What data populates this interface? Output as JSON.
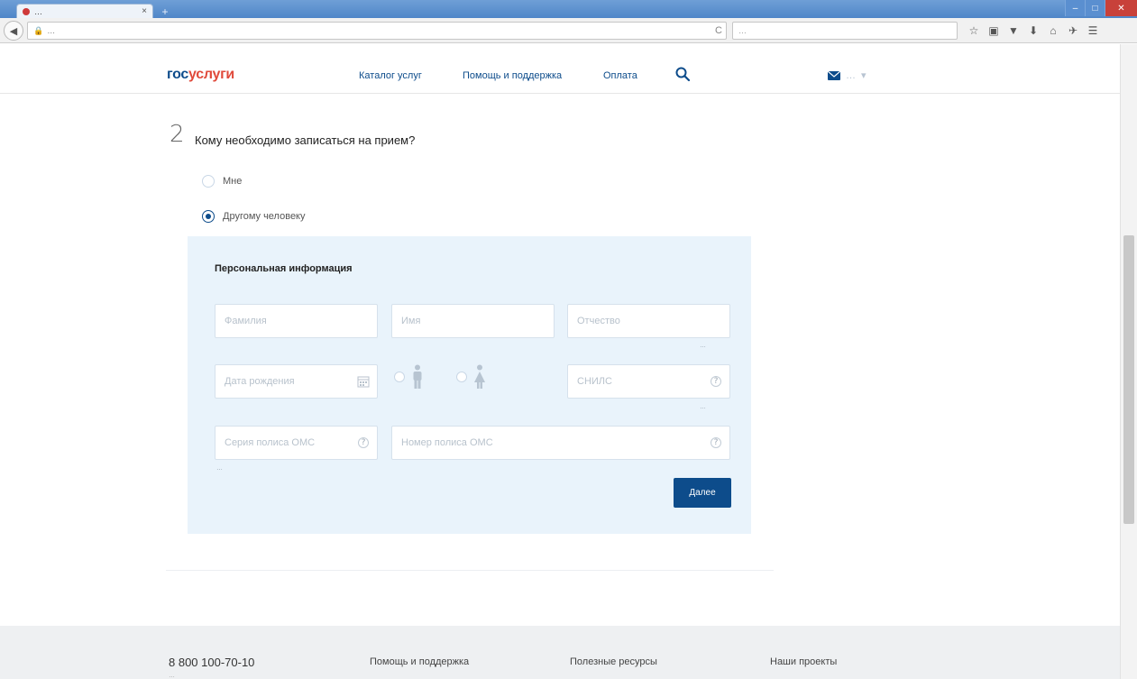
{
  "browser": {
    "tab_title": "…",
    "tab_close": "×",
    "new_tab": "+",
    "url": "…",
    "search_placeholder": "…",
    "window_controls": {
      "minimize": "–",
      "maximize": "□",
      "close": "✕"
    },
    "back_glyph": "◀",
    "reload_glyph": "C",
    "toolbar_glyphs": [
      "☆",
      "▣",
      "▼",
      "⬇",
      "⌂",
      "✈",
      "☰"
    ]
  },
  "header": {
    "logo_part1": "гос",
    "logo_part2": "услуги",
    "nav": [
      "Каталог услуг",
      "Помощь и поддержка",
      "Оплата"
    ],
    "user_name": "…"
  },
  "form": {
    "step_number": "2",
    "question": "Кому необходимо записаться на прием?",
    "options": [
      {
        "label": "Мне",
        "checked": false
      },
      {
        "label": "Другому человеку",
        "checked": true
      }
    ],
    "panel_title": "Персональная информация",
    "fields": {
      "last_name": "Фамилия",
      "first_name": "Имя",
      "patronymic": "Отчество",
      "birth_date": "Дата рождения",
      "snils": "СНИЛС",
      "oms_series": "Серия полиса ОМС",
      "oms_number": "Номер полиса ОМС"
    },
    "hints": {
      "patronymic": "…",
      "snils": "…",
      "oms_series": "…"
    },
    "next_button": "Далее"
  },
  "footer": {
    "phone": "8 800 100-70-10",
    "phone_sub": "…",
    "links": [
      "Помощь и поддержка",
      "Полезные ресурсы",
      "Наши проекты"
    ]
  },
  "colors": {
    "brand_blue": "#0d4c8b",
    "brand_red": "#e04a3b",
    "panel_bg": "#e9f3fb",
    "footer_bg": "#eef0f2"
  }
}
